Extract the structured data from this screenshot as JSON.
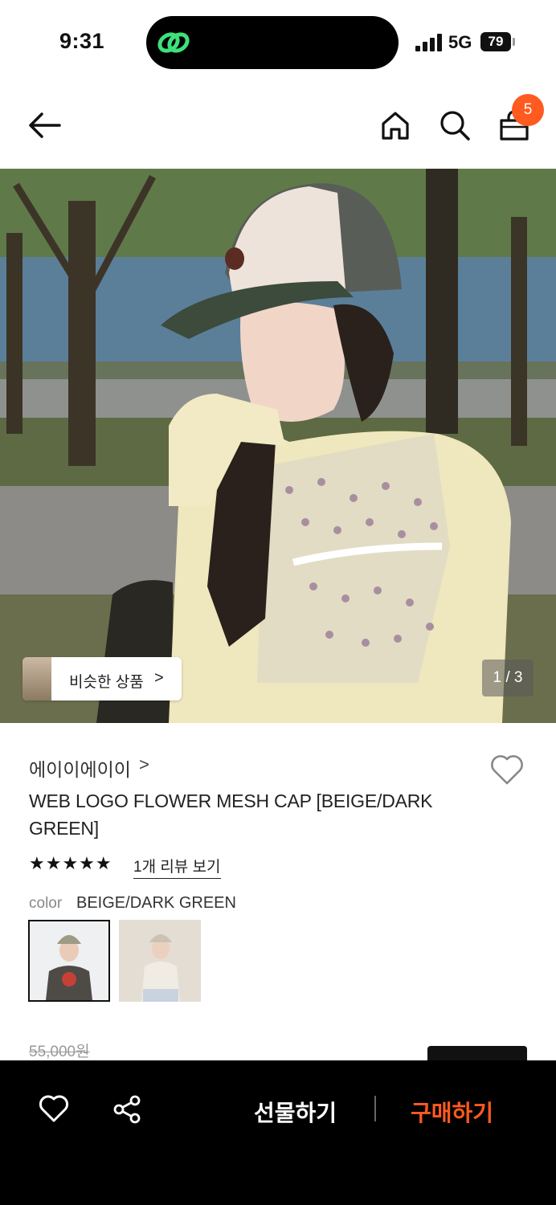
{
  "status_bar": {
    "time": "9:31",
    "network": "5G",
    "battery": "79"
  },
  "nav": {
    "cart_count": "5"
  },
  "hero": {
    "similar_label": "비슷한 상품",
    "similar_arrow": ">",
    "pager": "1 / 3"
  },
  "product": {
    "brand": "에이이에이이",
    "brand_arrow": ">",
    "title": "WEB LOGO FLOWER MESH CAP [BEIGE/DARK GREEN]",
    "stars": "★★★★★",
    "rating": 5,
    "reviews_link": "1개 리뷰 보기",
    "color_label": "color",
    "color_value": "BEIGE/DARK GREEN",
    "original_price": "55,000원"
  },
  "bottom_bar": {
    "gift": "선물하기",
    "buy": "구매하기"
  },
  "colors": {
    "accent": "#ff5a1f",
    "bottom_bar": "#000000"
  },
  "icons": [
    "back-arrow-icon",
    "home-icon",
    "search-icon",
    "shopping-bag-icon",
    "heart-icon",
    "share-icon"
  ]
}
